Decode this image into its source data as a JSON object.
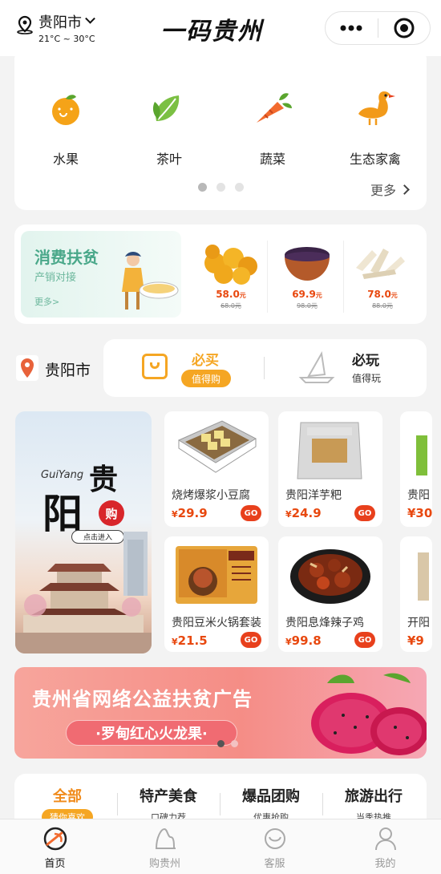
{
  "header": {
    "city": "贵阳市",
    "weather": "21°C ~ 30°C",
    "logo": "一码贵州",
    "more_icon": "more-dots-icon",
    "close_icon": "target-icon"
  },
  "categories": [
    {
      "label": "水果",
      "icon": "orange-icon"
    },
    {
      "label": "茶叶",
      "icon": "tea-leaf-icon"
    },
    {
      "label": "蔬菜",
      "icon": "carrot-icon"
    },
    {
      "label": "生态家禽",
      "icon": "goose-icon"
    }
  ],
  "carousel_dots": {
    "count": 3,
    "active": 0
  },
  "more_label": "更多",
  "poverty": {
    "title": "消费扶贫",
    "subtitle": "产销对接",
    "more": "更多>",
    "items": [
      {
        "price": "58.0",
        "unit": "元",
        "old": "68.0元"
      },
      {
        "price": "69.9",
        "unit": "元",
        "old": "98.0元"
      },
      {
        "price": "78.0",
        "unit": "元",
        "old": "88.0元"
      }
    ]
  },
  "local": {
    "city": "贵阳市",
    "must_buy": "必买",
    "must_buy_tag": "值得购",
    "must_play": "必玩",
    "must_play_tag": "值得玩"
  },
  "banner_gy": {
    "en": "GuiYang",
    "big1": "贵",
    "big2": "阳",
    "stamp": "购",
    "enter": "点击进入"
  },
  "products": [
    {
      "name": "烧烤爆浆小豆腐",
      "currency": "¥",
      "price": "29.9",
      "go": "GO"
    },
    {
      "name": "贵阳洋芋粑",
      "currency": "¥",
      "price": "24.9",
      "go": "GO"
    },
    {
      "name": "贵阳豆米火锅套装",
      "currency": "¥",
      "price": "21.5",
      "go": "GO"
    },
    {
      "name": "贵阳息烽辣子鸡",
      "currency": "¥",
      "price": "99.8",
      "go": "GO"
    }
  ],
  "partial_products": [
    {
      "name": "贵阳",
      "price": "¥30"
    },
    {
      "name": "开阳",
      "price": "¥9"
    }
  ],
  "ad": {
    "title": "贵州省网络公益扶贫广告",
    "subtitle": "·罗甸红心火龙果·"
  },
  "ad_dots": {
    "count": 2,
    "active": 0
  },
  "category_tabs": [
    {
      "label": "全部",
      "sub": "猜你喜欢",
      "active": true
    },
    {
      "label": "特产美食",
      "sub": "口碑力荐"
    },
    {
      "label": "爆品团购",
      "sub": "优惠抢购"
    },
    {
      "label": "旅游出行",
      "sub": "当季热推"
    }
  ],
  "tabbar": [
    {
      "label": "首页",
      "icon": "home-icon",
      "active": true
    },
    {
      "label": "购贵州",
      "icon": "shop-icon"
    },
    {
      "label": "客服",
      "icon": "service-icon"
    },
    {
      "label": "我的",
      "icon": "profile-icon"
    }
  ],
  "colors": {
    "accent": "#f29a1a",
    "brand_green": "#4aa88a",
    "price_red": "#e8480f"
  }
}
